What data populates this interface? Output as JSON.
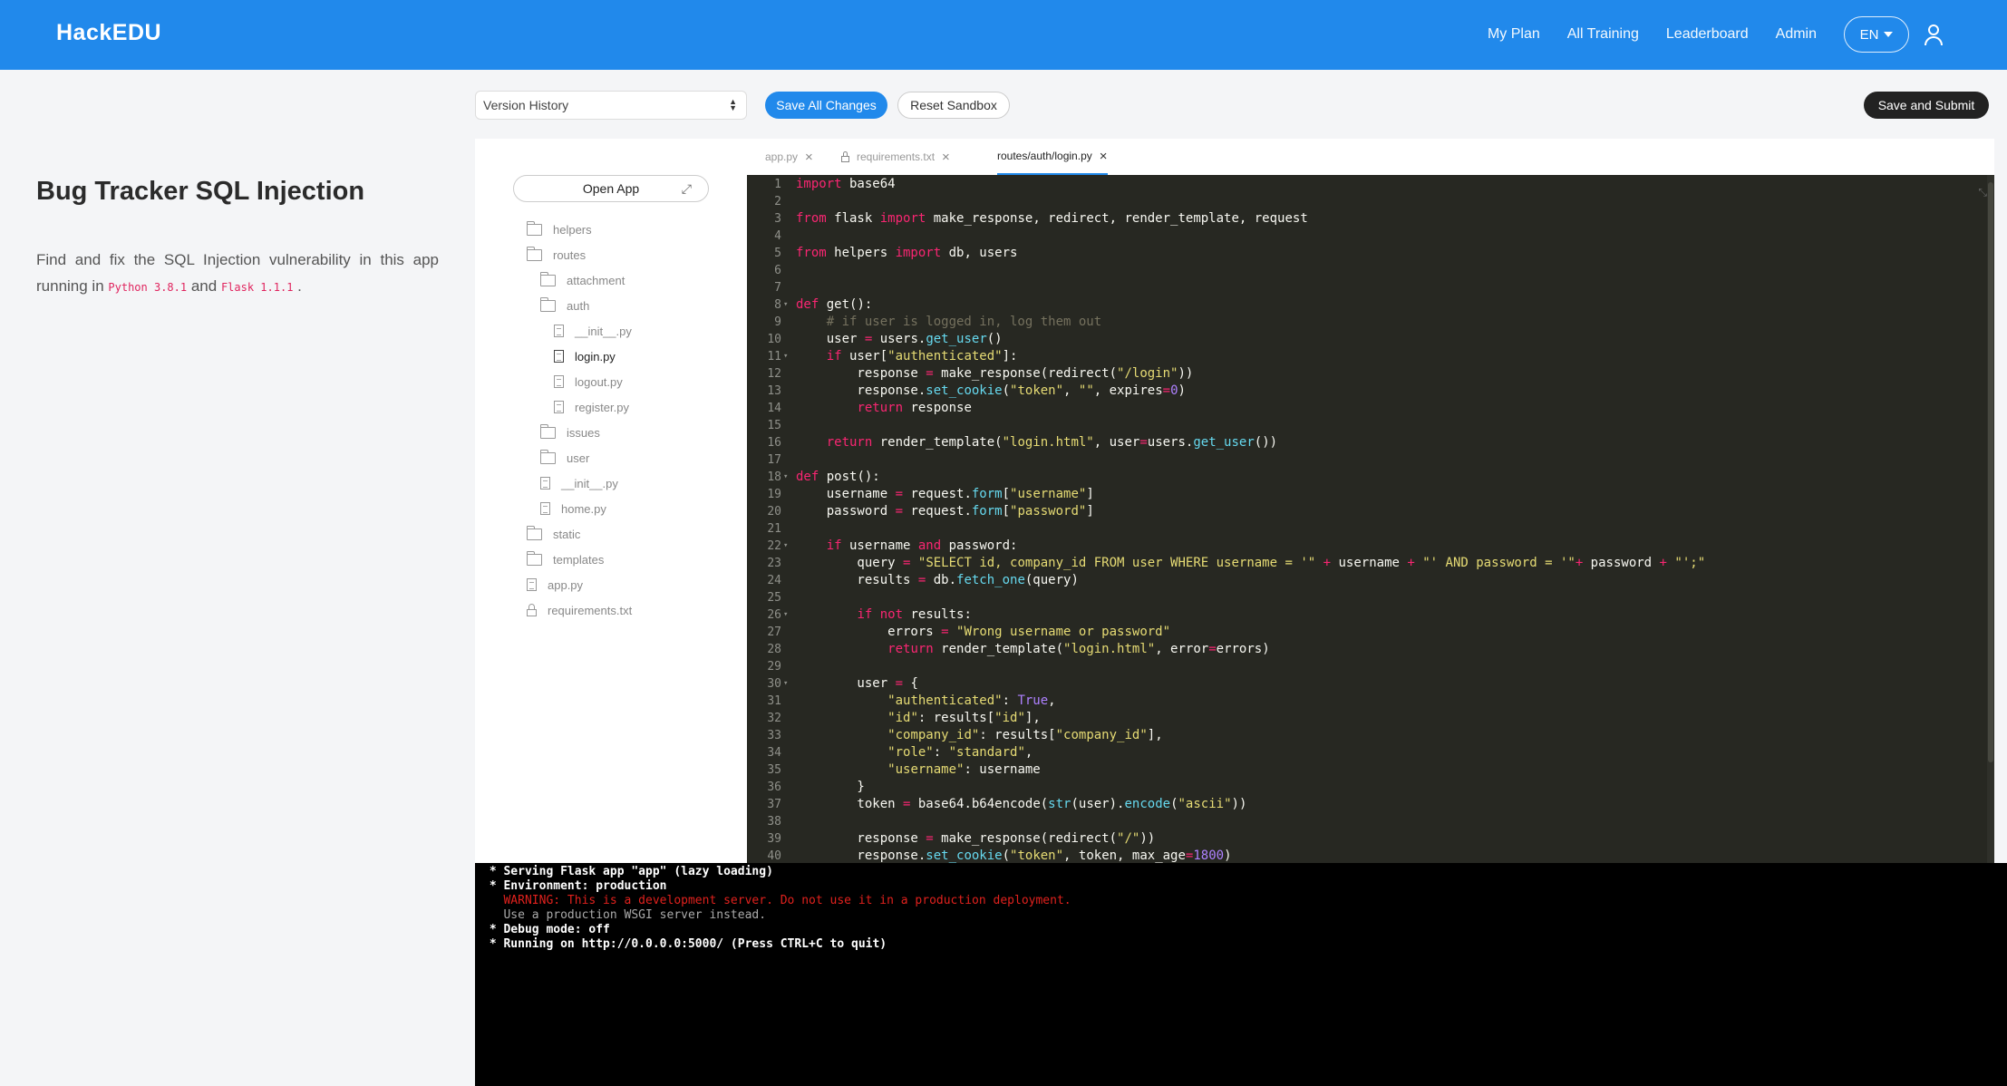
{
  "header": {
    "logo": "HackEDU",
    "nav": [
      "My Plan",
      "All Training",
      "Leaderboard",
      "Admin"
    ],
    "language": "EN"
  },
  "lesson": {
    "title": "Bug Tracker SQL Injection",
    "desc_before": "Find and fix the SQL Injection vulnerability in this app running in",
    "python_tag": "Python 3.8.1",
    "and": "and",
    "flask_tag": "Flask 1.1.1",
    "end": "."
  },
  "toolbar": {
    "version_history": "Version History",
    "save_all": "Save All Changes",
    "reset": "Reset Sandbox",
    "submit": "Save and Submit"
  },
  "files": {
    "open_app": "Open App",
    "tree": [
      {
        "label": "helpers",
        "type": "folder",
        "depth": 0
      },
      {
        "label": "routes",
        "type": "folder",
        "depth": 0
      },
      {
        "label": "attachment",
        "type": "folder",
        "depth": 1
      },
      {
        "label": "auth",
        "type": "folder",
        "depth": 1
      },
      {
        "label": "__init__.py",
        "type": "file",
        "depth": 2
      },
      {
        "label": "login.py",
        "type": "file",
        "depth": 2,
        "active": true
      },
      {
        "label": "logout.py",
        "type": "file",
        "depth": 2
      },
      {
        "label": "register.py",
        "type": "file",
        "depth": 2
      },
      {
        "label": "issues",
        "type": "folder",
        "depth": 1
      },
      {
        "label": "user",
        "type": "folder",
        "depth": 1
      },
      {
        "label": "__init__.py",
        "type": "file",
        "depth": 1
      },
      {
        "label": "home.py",
        "type": "file",
        "depth": 1
      },
      {
        "label": "static",
        "type": "folder",
        "depth": 0
      },
      {
        "label": "templates",
        "type": "folder",
        "depth": 0
      },
      {
        "label": "app.py",
        "type": "file",
        "depth": 0
      },
      {
        "label": "requirements.txt",
        "type": "lock",
        "depth": 0
      }
    ]
  },
  "tabs": [
    {
      "label": "app.py",
      "locked": false,
      "active": false
    },
    {
      "label": "requirements.txt",
      "locked": true,
      "active": false
    },
    {
      "label": "routes/auth/login.py",
      "locked": false,
      "active": true
    }
  ],
  "code": [
    "import base64",
    "",
    "from flask import make_response, redirect, render_template, request",
    "",
    "from helpers import db, users",
    "",
    "",
    "def get():",
    "    # if user is logged in, log them out",
    "    user = users.get_user()",
    "    if user[\"authenticated\"]:",
    "        response = make_response(redirect(\"/login\"))",
    "        response.set_cookie(\"token\", \"\", expires=0)",
    "        return response",
    "",
    "    return render_template(\"login.html\", user=users.get_user())",
    "",
    "def post():",
    "    username = request.form[\"username\"]",
    "    password = request.form[\"password\"]",
    "",
    "    if username and password:",
    "        query = \"SELECT id, company_id FROM user WHERE username = '\" + username + \"' AND password = '\"+ password + \"';\"",
    "        results = db.fetch_one(query)",
    "",
    "        if not results:",
    "            errors = \"Wrong username or password\"",
    "            return render_template(\"login.html\", error=errors)",
    "",
    "        user = {",
    "            \"authenticated\": True,",
    "            \"id\": results[\"id\"],",
    "            \"company_id\": results[\"company_id\"],",
    "            \"role\": \"standard\",",
    "            \"username\": username",
    "        }",
    "        token = base64.b64encode(str(user).encode(\"ascii\"))",
    "",
    "        response = make_response(redirect(\"/\"))",
    "        response.set_cookie(\"token\", token, max_age=1800)"
  ],
  "fold_lines": [
    8,
    11,
    18,
    22,
    26,
    30
  ],
  "console": [
    {
      "text": " * Serving Flask app \"app\" (lazy loading)",
      "style": "normal"
    },
    {
      "text": " * Environment: production",
      "style": "normal"
    },
    {
      "text": "   WARNING: This is a development server. Do not use it in a production deployment.",
      "style": "warn"
    },
    {
      "text": "   Use a production WSGI server instead.",
      "style": "dim"
    },
    {
      "text": " * Debug mode: off",
      "style": "normal"
    },
    {
      "text": " * Running on http://0.0.0.0:5000/ (Press CTRL+C to quit)",
      "style": "normal"
    }
  ],
  "colors": {
    "brand": "#2189eb",
    "editor_bg": "#272822",
    "keyword": "#f92672",
    "string": "#e6db74",
    "function": "#66d9ef",
    "comment": "#75715e",
    "number": "#ae81ff"
  }
}
